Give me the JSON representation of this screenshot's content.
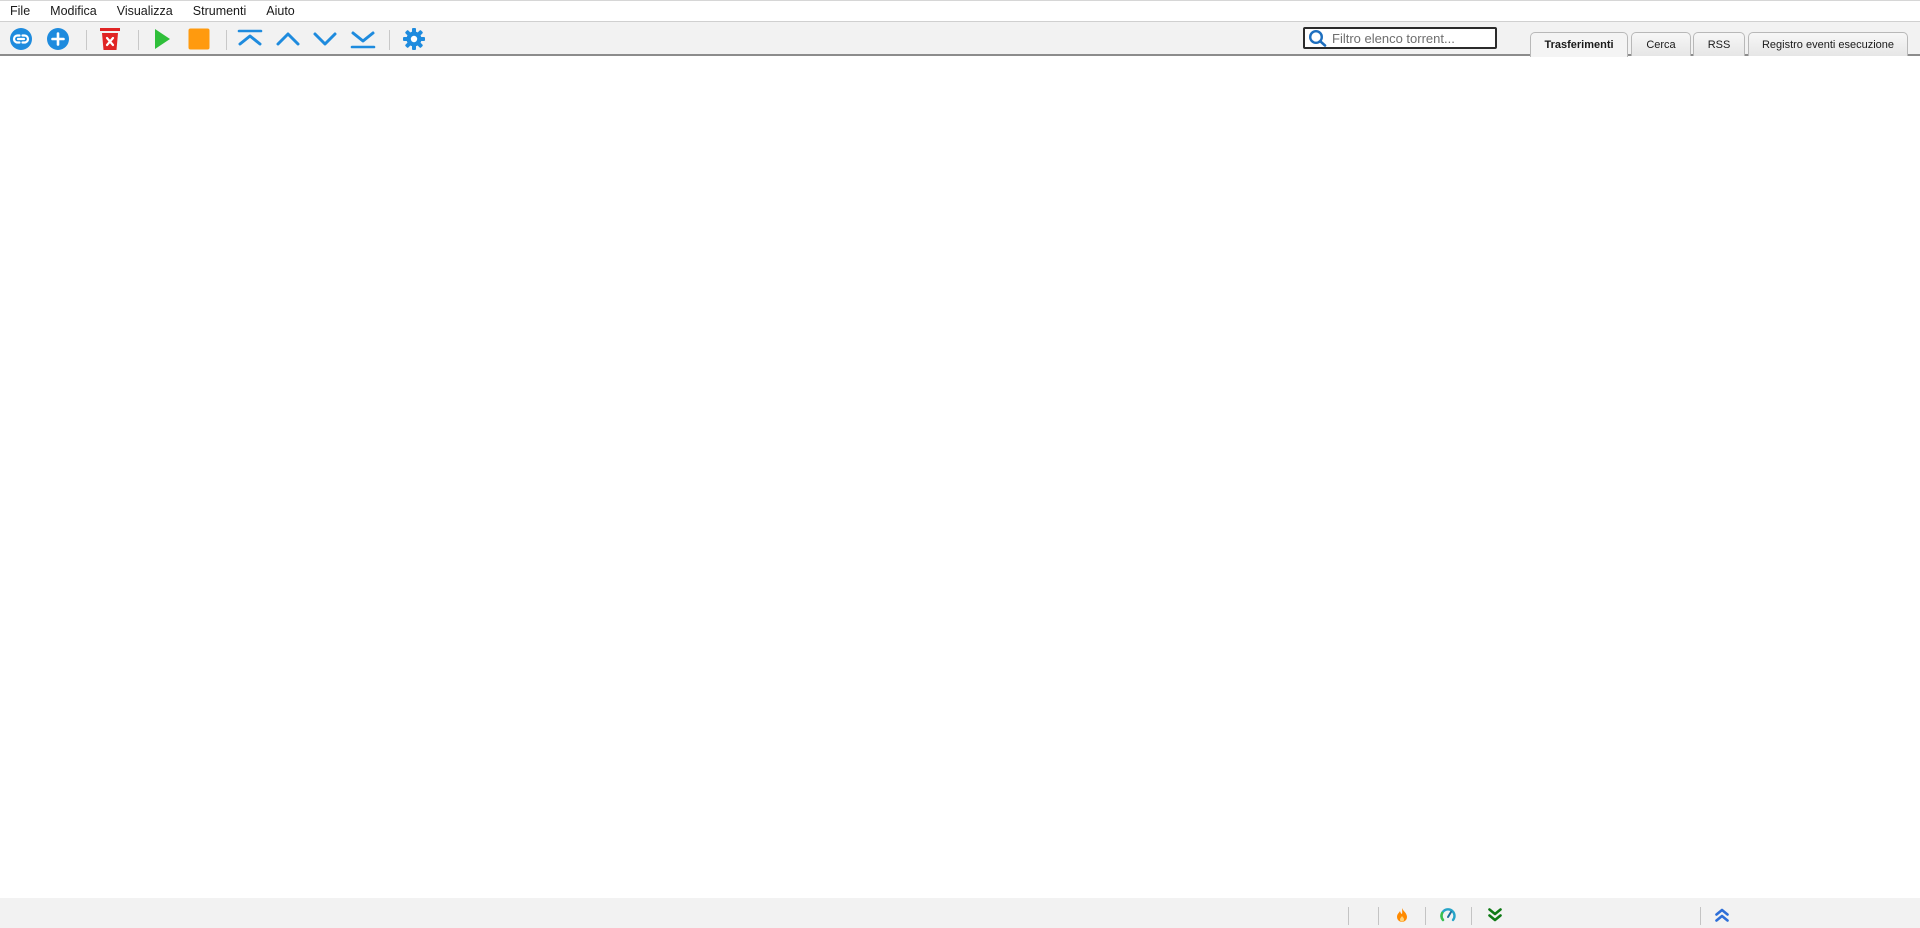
{
  "menu": {
    "file": "File",
    "edit": "Modifica",
    "view": "Visualizza",
    "tools": "Strumenti",
    "help": "Aiuto"
  },
  "toolbar": {
    "icons": {
      "add_link": "link-icon",
      "add_torrent": "plus-circle-icon",
      "delete": "trash-icon",
      "resume": "play-icon",
      "pause": "stop-icon",
      "top_priority": "priority-top-icon",
      "increase_priority": "priority-up-icon",
      "decrease_priority": "priority-down-icon",
      "bottom_priority": "priority-bottom-icon",
      "options": "gear-icon"
    },
    "colors": {
      "blue": "#1e8bde",
      "red": "#e02424",
      "green": "#2fbf3a",
      "orange": "#ff9a0e"
    }
  },
  "search": {
    "placeholder": "Filtro elenco torrent..."
  },
  "tabs": {
    "transfers": "Trasferimenti",
    "search": "Cerca",
    "rss": "RSS",
    "log": "Registro eventi esecuzione"
  },
  "statusbar": {
    "icons": {
      "dht": "flame-icon",
      "connection": "speed-gauge-icon",
      "download": "double-chevron-down-icon",
      "upload": "double-chevron-up-icon"
    },
    "colors": {
      "flame": "#ff8a00",
      "gauge": "#27a4c8",
      "download": "#0f7a16",
      "upload": "#2e6fd8"
    }
  }
}
